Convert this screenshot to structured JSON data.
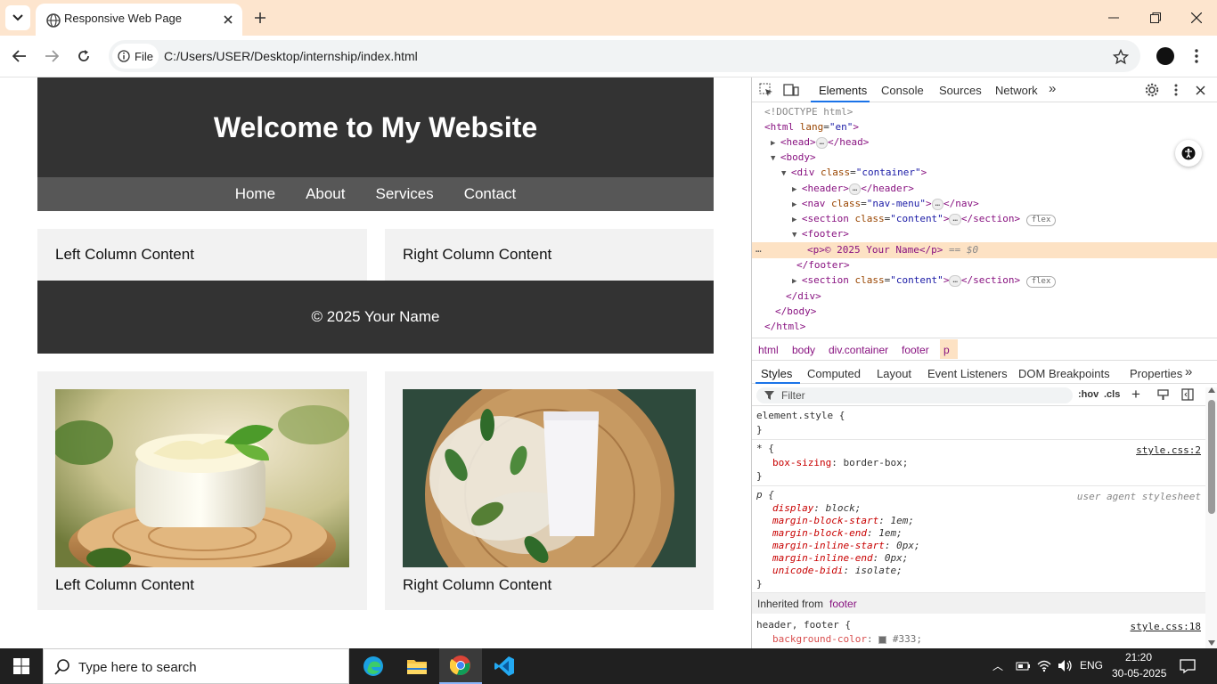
{
  "browser": {
    "tab_title": "Responsive Web Page",
    "omnibox_chip": "File",
    "url": "C:/Users/USER/Desktop/internship/index.html"
  },
  "page": {
    "header_title": "Welcome to My Website",
    "nav": [
      "Home",
      "About",
      "Services",
      "Contact"
    ],
    "left_col": "Left Column Content",
    "right_col": "Right Column Content",
    "footer_text": "© 2025 Your Name",
    "left_col_2": "Left Column Content",
    "right_col_2": "Right Column Content"
  },
  "devtools": {
    "tabs": [
      "Elements",
      "Console",
      "Sources",
      "Network"
    ],
    "dom": {
      "doctype": "<!DOCTYPE html>",
      "html_open": "<html",
      "html_lang_attr": "lang",
      "html_lang_val": "\"en\"",
      "head": "<head>",
      "head_close": "</head>",
      "body_open": "<body>",
      "div_open": "<div",
      "div_class_attr": "class",
      "div_class_val": "\"container\"",
      "header": "<header>",
      "header_close": "</header>",
      "nav_open": "<nav",
      "nav_class_val": "\"nav-menu\"",
      "nav_close": "</nav>",
      "section_open": "<section",
      "section_class_val": "\"content\"",
      "section_close": "</section>",
      "footer_open": "<footer>",
      "p_line": "<p>© 2025 Your Name</p>",
      "eq": "== $0",
      "footer_close": "</footer>",
      "div_close": "</div>",
      "body_close": "</body>",
      "html_close": "</html>",
      "ellipsis": "…",
      "flex": "flex"
    },
    "breadcrumbs": [
      "html",
      "body",
      "div.container",
      "footer",
      "p"
    ],
    "styles_tabs": [
      "Styles",
      "Computed",
      "Layout",
      "Event Listeners",
      "DOM Breakpoints",
      "Properties"
    ],
    "filter_placeholder": "Filter",
    "hov": ":hov",
    "cls": ".cls",
    "rules": {
      "element_style": "element.style {",
      "close": "}",
      "star_sel": "* {",
      "star_src": "style.css:2",
      "box_sizing_prop": "box-sizing",
      "box_sizing_val": "border-box;",
      "p_sel": "p {",
      "p_src": "user agent stylesheet",
      "p_props": [
        [
          "display",
          "block;"
        ],
        [
          "margin-block-start",
          "1em;"
        ],
        [
          "margin-block-end",
          "1em;"
        ],
        [
          "margin-inline-start",
          "0px;"
        ],
        [
          "margin-inline-end",
          "0px;"
        ],
        [
          "unicode-bidi",
          "isolate;"
        ]
      ],
      "inherited_label": "Inherited from",
      "inherited_from": "footer",
      "hf_sel": "header, footer {",
      "hf_src": "style.css:18",
      "bg_prop": "background-color",
      "bg_val": "#333;"
    }
  },
  "taskbar": {
    "search_placeholder": "Type here to search",
    "lang": "ENG",
    "time": "21:20",
    "date": "30-05-2025"
  },
  "colors": {
    "tabbar_bg": "#fde5ce",
    "header_bg": "#333333",
    "nav_bg": "#575757",
    "accent_devtools": "#1a73e8",
    "taskbar_bg": "#202020"
  }
}
